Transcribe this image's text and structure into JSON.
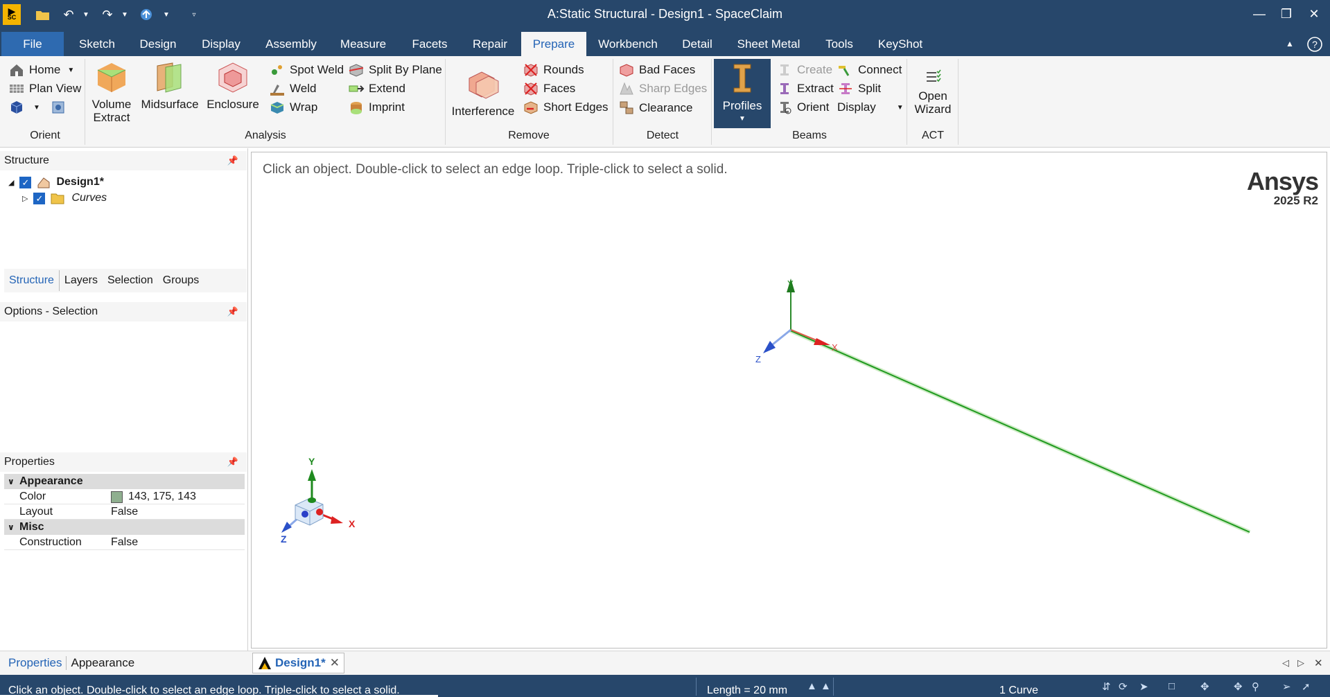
{
  "window": {
    "title": "A:Static Structural - Design1 - SpaceClaim",
    "app_icon_text": "SC"
  },
  "ribbon_tabs": [
    "File",
    "Sketch",
    "Design",
    "Display",
    "Assembly",
    "Measure",
    "Facets",
    "Repair",
    "Prepare",
    "Workbench",
    "Detail",
    "Sheet Metal",
    "Tools",
    "KeyShot"
  ],
  "active_tab": "Prepare",
  "ribbon": {
    "orient": {
      "label": "Orient",
      "home": "Home",
      "plan_view": "Plan View"
    },
    "analysis": {
      "label": "Analysis",
      "volume_extract": "Volume Extract",
      "midsurface": "Midsurface",
      "enclosure": "Enclosure",
      "spot_weld": "Spot Weld",
      "weld": "Weld",
      "wrap": "Wrap",
      "split_by_plane": "Split By Plane",
      "extend": "Extend",
      "imprint": "Imprint"
    },
    "remove": {
      "label": "Remove",
      "interference": "Interference",
      "rounds": "Rounds",
      "faces": "Faces",
      "short_edges": "Short Edges"
    },
    "detect": {
      "label": "Detect",
      "bad_faces": "Bad Faces",
      "sharp_edges": "Sharp Edges",
      "clearance": "Clearance"
    },
    "beams": {
      "label": "Beams",
      "profiles": "Profiles",
      "create": "Create",
      "extract": "Extract",
      "orient": "Orient",
      "connect": "Connect",
      "split": "Split",
      "display": "Display"
    },
    "act": {
      "label": "ACT",
      "open_wizard": "Open Wizard"
    }
  },
  "structure": {
    "header": "Structure",
    "root": "Design1*",
    "child": "Curves",
    "tabs": [
      "Structure",
      "Layers",
      "Selection",
      "Groups"
    ]
  },
  "options": {
    "header": "Options - Selection"
  },
  "properties": {
    "header": "Properties",
    "sections": [
      {
        "name": "Appearance",
        "rows": [
          {
            "key": "Color",
            "value": "143, 175, 143"
          },
          {
            "key": "Layout",
            "value": "False"
          }
        ]
      },
      {
        "name": "Misc",
        "rows": [
          {
            "key": "Construction",
            "value": "False"
          }
        ]
      }
    ],
    "tabs": [
      "Properties",
      "Appearance"
    ]
  },
  "viewport": {
    "hint": "Click an object. Double-click to select an edge loop. Triple-click to select a solid.",
    "brand": "Ansys",
    "version": "2025 R2",
    "axes": {
      "x": "X",
      "y": "Y",
      "z": "Z"
    }
  },
  "doc_tab": "Design1*",
  "status": {
    "message": "Click an object. Double-click to select an edge loop. Triple-click to select a solid.",
    "length": "Length = 20 mm",
    "selection": "1 Curve"
  },
  "colors": {
    "titlebar": "#27476b",
    "accent": "#2464b6",
    "curve": "#1f9a1f",
    "swatch": "#8faf8f"
  }
}
